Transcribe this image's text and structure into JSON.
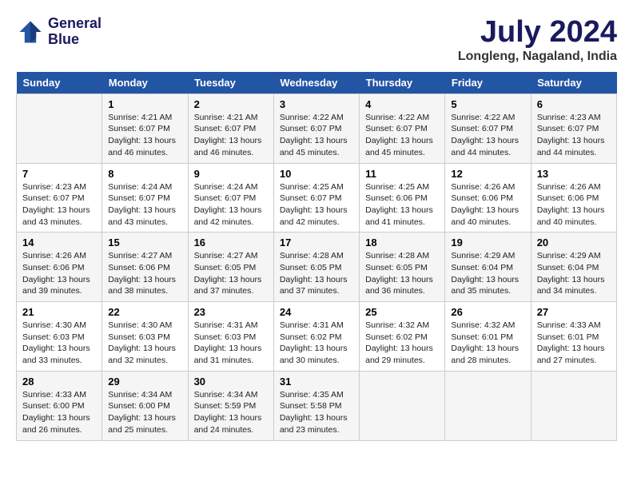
{
  "logo": {
    "line1": "General",
    "line2": "Blue"
  },
  "title": "July 2024",
  "location": "Longleng, Nagaland, India",
  "days_header": [
    "Sunday",
    "Monday",
    "Tuesday",
    "Wednesday",
    "Thursday",
    "Friday",
    "Saturday"
  ],
  "weeks": [
    [
      {
        "day": "",
        "info": ""
      },
      {
        "day": "1",
        "info": "Sunrise: 4:21 AM\nSunset: 6:07 PM\nDaylight: 13 hours\nand 46 minutes."
      },
      {
        "day": "2",
        "info": "Sunrise: 4:21 AM\nSunset: 6:07 PM\nDaylight: 13 hours\nand 46 minutes."
      },
      {
        "day": "3",
        "info": "Sunrise: 4:22 AM\nSunset: 6:07 PM\nDaylight: 13 hours\nand 45 minutes."
      },
      {
        "day": "4",
        "info": "Sunrise: 4:22 AM\nSunset: 6:07 PM\nDaylight: 13 hours\nand 45 minutes."
      },
      {
        "day": "5",
        "info": "Sunrise: 4:22 AM\nSunset: 6:07 PM\nDaylight: 13 hours\nand 44 minutes."
      },
      {
        "day": "6",
        "info": "Sunrise: 4:23 AM\nSunset: 6:07 PM\nDaylight: 13 hours\nand 44 minutes."
      }
    ],
    [
      {
        "day": "7",
        "info": "Sunrise: 4:23 AM\nSunset: 6:07 PM\nDaylight: 13 hours\nand 43 minutes."
      },
      {
        "day": "8",
        "info": "Sunrise: 4:24 AM\nSunset: 6:07 PM\nDaylight: 13 hours\nand 43 minutes."
      },
      {
        "day": "9",
        "info": "Sunrise: 4:24 AM\nSunset: 6:07 PM\nDaylight: 13 hours\nand 42 minutes."
      },
      {
        "day": "10",
        "info": "Sunrise: 4:25 AM\nSunset: 6:07 PM\nDaylight: 13 hours\nand 42 minutes."
      },
      {
        "day": "11",
        "info": "Sunrise: 4:25 AM\nSunset: 6:06 PM\nDaylight: 13 hours\nand 41 minutes."
      },
      {
        "day": "12",
        "info": "Sunrise: 4:26 AM\nSunset: 6:06 PM\nDaylight: 13 hours\nand 40 minutes."
      },
      {
        "day": "13",
        "info": "Sunrise: 4:26 AM\nSunset: 6:06 PM\nDaylight: 13 hours\nand 40 minutes."
      }
    ],
    [
      {
        "day": "14",
        "info": "Sunrise: 4:26 AM\nSunset: 6:06 PM\nDaylight: 13 hours\nand 39 minutes."
      },
      {
        "day": "15",
        "info": "Sunrise: 4:27 AM\nSunset: 6:06 PM\nDaylight: 13 hours\nand 38 minutes."
      },
      {
        "day": "16",
        "info": "Sunrise: 4:27 AM\nSunset: 6:05 PM\nDaylight: 13 hours\nand 37 minutes."
      },
      {
        "day": "17",
        "info": "Sunrise: 4:28 AM\nSunset: 6:05 PM\nDaylight: 13 hours\nand 37 minutes."
      },
      {
        "day": "18",
        "info": "Sunrise: 4:28 AM\nSunset: 6:05 PM\nDaylight: 13 hours\nand 36 minutes."
      },
      {
        "day": "19",
        "info": "Sunrise: 4:29 AM\nSunset: 6:04 PM\nDaylight: 13 hours\nand 35 minutes."
      },
      {
        "day": "20",
        "info": "Sunrise: 4:29 AM\nSunset: 6:04 PM\nDaylight: 13 hours\nand 34 minutes."
      }
    ],
    [
      {
        "day": "21",
        "info": "Sunrise: 4:30 AM\nSunset: 6:03 PM\nDaylight: 13 hours\nand 33 minutes."
      },
      {
        "day": "22",
        "info": "Sunrise: 4:30 AM\nSunset: 6:03 PM\nDaylight: 13 hours\nand 32 minutes."
      },
      {
        "day": "23",
        "info": "Sunrise: 4:31 AM\nSunset: 6:03 PM\nDaylight: 13 hours\nand 31 minutes."
      },
      {
        "day": "24",
        "info": "Sunrise: 4:31 AM\nSunset: 6:02 PM\nDaylight: 13 hours\nand 30 minutes."
      },
      {
        "day": "25",
        "info": "Sunrise: 4:32 AM\nSunset: 6:02 PM\nDaylight: 13 hours\nand 29 minutes."
      },
      {
        "day": "26",
        "info": "Sunrise: 4:32 AM\nSunset: 6:01 PM\nDaylight: 13 hours\nand 28 minutes."
      },
      {
        "day": "27",
        "info": "Sunrise: 4:33 AM\nSunset: 6:01 PM\nDaylight: 13 hours\nand 27 minutes."
      }
    ],
    [
      {
        "day": "28",
        "info": "Sunrise: 4:33 AM\nSunset: 6:00 PM\nDaylight: 13 hours\nand 26 minutes."
      },
      {
        "day": "29",
        "info": "Sunrise: 4:34 AM\nSunset: 6:00 PM\nDaylight: 13 hours\nand 25 minutes."
      },
      {
        "day": "30",
        "info": "Sunrise: 4:34 AM\nSunset: 5:59 PM\nDaylight: 13 hours\nand 24 minutes."
      },
      {
        "day": "31",
        "info": "Sunrise: 4:35 AM\nSunset: 5:58 PM\nDaylight: 13 hours\nand 23 minutes."
      },
      {
        "day": "",
        "info": ""
      },
      {
        "day": "",
        "info": ""
      },
      {
        "day": "",
        "info": ""
      }
    ]
  ]
}
